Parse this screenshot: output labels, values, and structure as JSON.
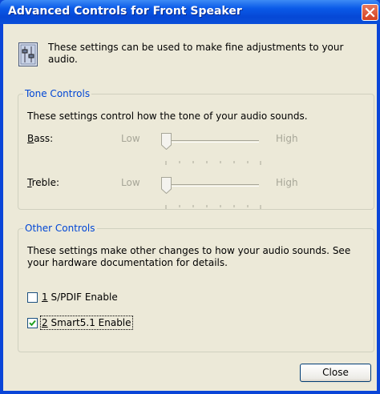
{
  "window": {
    "title": "Advanced Controls for Front Speaker",
    "close_icon": "close-icon"
  },
  "intro": {
    "text": "These settings can be used to make fine adjustments to your audio.",
    "icon": "mixer-icon"
  },
  "tone_controls": {
    "legend": "Tone Controls",
    "description": "These settings control how the tone of your audio sounds.",
    "bass": {
      "label_accel": "B",
      "label_rest": "ass:",
      "low": "Low",
      "high": "High",
      "level": 0
    },
    "treble": {
      "label_accel": "T",
      "label_rest": "reble:",
      "low": "Low",
      "high": "High",
      "level": 0
    }
  },
  "other_controls": {
    "legend": "Other Controls",
    "description": "These settings make other changes to how your audio sounds.  See your hardware documentation for details.",
    "options": [
      {
        "accel": "1",
        "label": " S/PDIF Enable",
        "checked": false
      },
      {
        "accel": "2",
        "label": " Smart5.1 Enable",
        "checked": true
      }
    ]
  },
  "buttons": {
    "close": "Close"
  },
  "colors": {
    "title_bar": "#0a5ae8",
    "dialog_bg": "#ece9d8",
    "legend_text": "#0046d5",
    "disabled_text": "#a7a698"
  }
}
